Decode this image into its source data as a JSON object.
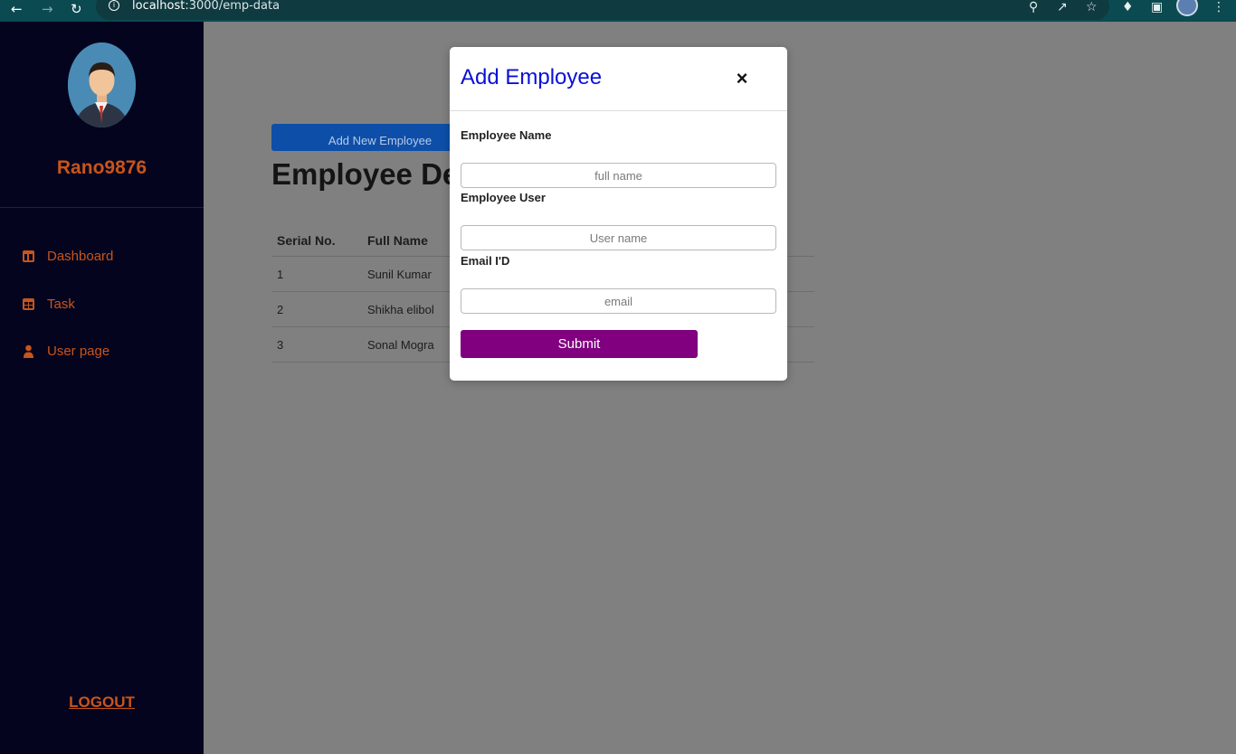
{
  "browser": {
    "url_host": "localhost",
    "url_rest": ":3000/emp-data",
    "back_icon": "back-arrow-icon",
    "forward_icon": "forward-arrow-icon",
    "reload_icon": "reload-icon"
  },
  "sidebar": {
    "username": "Rano9876",
    "items": [
      {
        "label": "Dashboard",
        "icon": "dashboard-icon"
      },
      {
        "label": "Task",
        "icon": "table-icon"
      },
      {
        "label": "User page",
        "icon": "user-icon"
      }
    ],
    "logout_label": "LOGOUT"
  },
  "main": {
    "add_button_label": "Add New Employee",
    "page_title": "Employee Deta",
    "table": {
      "headers": [
        "Serial No.",
        "Full Name"
      ],
      "rows": [
        [
          "1",
          "Sunil Kumar"
        ],
        [
          "2",
          "Shikha elibol"
        ],
        [
          "3",
          "Sonal Mogra"
        ]
      ]
    }
  },
  "modal": {
    "title": "Add Employee",
    "close_label": "×",
    "fields": [
      {
        "label": "Employee Name",
        "placeholder": "full name",
        "value": ""
      },
      {
        "label": "Employee User",
        "placeholder": "User name",
        "value": ""
      },
      {
        "label": "Email I'D",
        "placeholder": "email",
        "value": ""
      }
    ],
    "submit_label": "Submit"
  },
  "colors": {
    "sidebar_bg": "#05041f",
    "accent_orange": "#c7551a",
    "modal_title": "#0a10d6",
    "submit_bg": "#800080",
    "overlay": "#808080"
  }
}
